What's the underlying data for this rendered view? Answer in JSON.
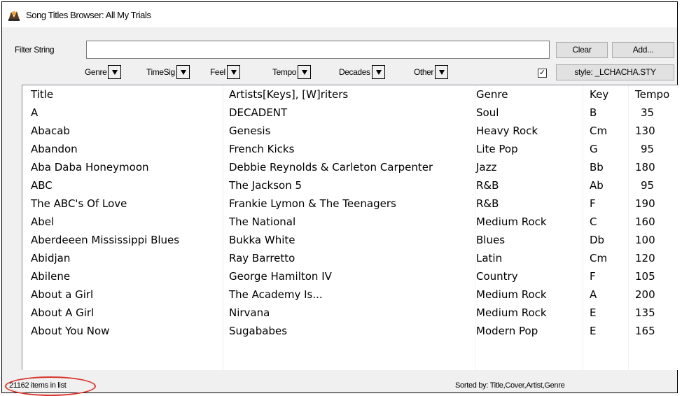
{
  "window": {
    "title": "Song Titles Browser: All My Trials"
  },
  "filter": {
    "label": "Filter String",
    "value": "",
    "placeholder": "",
    "clear_label": "Clear",
    "add_label": "Add..."
  },
  "dropdowns": [
    "Genre",
    "TimeSig",
    "Feel",
    "Tempo",
    "Decades",
    "Other"
  ],
  "style_checkbox": {
    "checked": true,
    "mark": "✓"
  },
  "style_button_label": "style: _LCHACHA.STY",
  "table": {
    "columns": [
      "Title",
      "Artists[Keys], [W]riters",
      "Genre",
      "Key",
      "Tempo"
    ],
    "rows": [
      [
        "A",
        "DECADENT",
        "Soul",
        "B",
        "35"
      ],
      [
        "Abacab",
        "Genesis",
        "Heavy Rock",
        "Cm",
        "130"
      ],
      [
        "Abandon",
        "French Kicks",
        "Lite Pop",
        "G",
        "95"
      ],
      [
        "Aba Daba Honeymoon",
        "Debbie Reynolds & Carleton Carpenter",
        "Jazz",
        "Bb",
        "180"
      ],
      [
        "ABC",
        "The Jackson 5",
        "R&B",
        "Ab",
        "95"
      ],
      [
        "The ABC's Of Love",
        "Frankie Lymon & The Teenagers",
        "R&B",
        "F",
        "190"
      ],
      [
        "Abel",
        "The National",
        "Medium Rock",
        "C",
        "160"
      ],
      [
        "Aberdeeen Mississippi Blues",
        "Bukka White",
        "Blues",
        "Db",
        "100"
      ],
      [
        "Abidjan",
        "Ray Barretto",
        "Latin",
        "Cm",
        "120"
      ],
      [
        "Abilene",
        "George Hamilton IV",
        "Country",
        "F",
        "105"
      ],
      [
        "About a Girl",
        "The Academy Is...",
        "Medium Rock",
        "A",
        "200"
      ],
      [
        "About A Girl",
        "Nirvana",
        "Medium Rock",
        "E",
        "135"
      ],
      [
        "About You Now",
        "Sugababes",
        "Modern Pop",
        "E",
        "165"
      ]
    ]
  },
  "status": {
    "count_text": "21162 items in list",
    "sorted_text": "Sorted by: Title,Cover,Artist,Genre"
  },
  "colors": {
    "highlight_ellipse": "#d9342b",
    "window_bg": "#f0f0f0"
  }
}
